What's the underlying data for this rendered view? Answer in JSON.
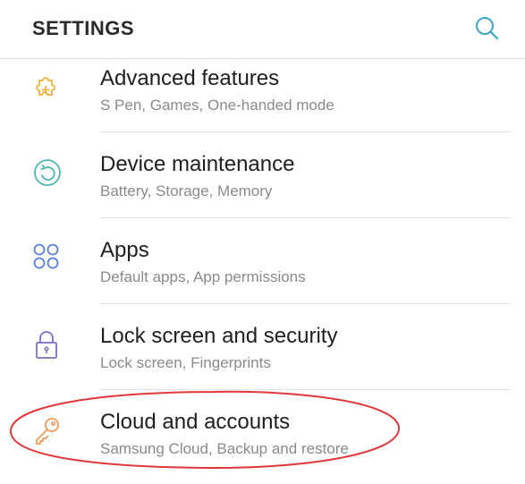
{
  "header": {
    "title": "SETTINGS",
    "search_icon": "search-icon"
  },
  "items": [
    {
      "title": "Advanced features",
      "subtitle": "S Pen, Games, One-handed mode",
      "icon": "puzzle-plus-icon",
      "icon_color": "#F0B13A"
    },
    {
      "title": "Device maintenance",
      "subtitle": "Battery, Storage, Memory",
      "icon": "refresh-circle-icon",
      "icon_color": "#4DB6AC"
    },
    {
      "title": "Apps",
      "subtitle": "Default apps, App permissions",
      "icon": "apps-grid-icon",
      "icon_color": "#5B7FD6"
    },
    {
      "title": "Lock screen and security",
      "subtitle": "Lock screen, Fingerprints",
      "icon": "padlock-icon",
      "icon_color": "#7A6FC6"
    },
    {
      "title": "Cloud and accounts",
      "subtitle": "Samsung Cloud, Backup and restore",
      "icon": "key-icon",
      "icon_color": "#F09A5A"
    }
  ],
  "colors": {
    "accent": "#3FA4C6",
    "annotation": "#E0383B",
    "divider": "#E4E4E4",
    "subtitle": "#8A8A8A"
  }
}
